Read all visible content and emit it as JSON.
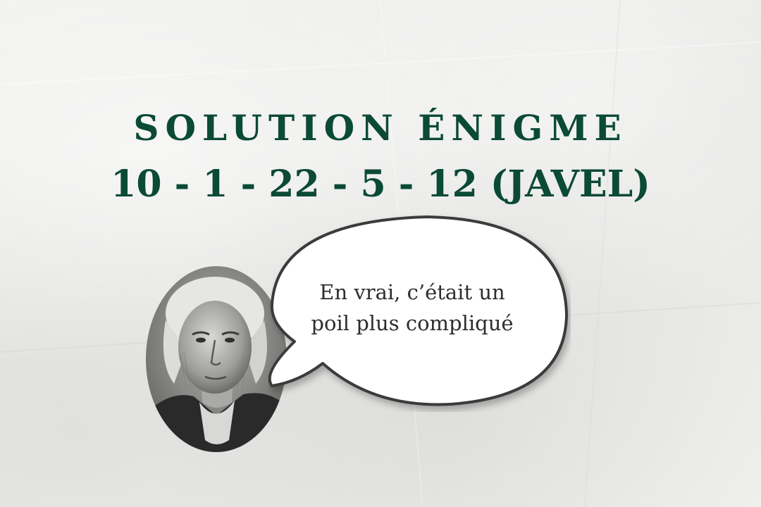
{
  "title": {
    "line1": "SOLUTION ÉNIGME",
    "line2": "10 - 1 - 22 - 5 - 12 (JAVEL)"
  },
  "speech_bubble": {
    "line1": "En vrai, c’était un",
    "line2": "poil plus compliqué"
  },
  "portrait": {
    "icon": "engraved-portrait-icon"
  },
  "colors": {
    "title": "#0b4a35",
    "bubble_text": "#2e2e2e",
    "bubble_outline": "#3a3a3a",
    "background": "#ededeb"
  }
}
